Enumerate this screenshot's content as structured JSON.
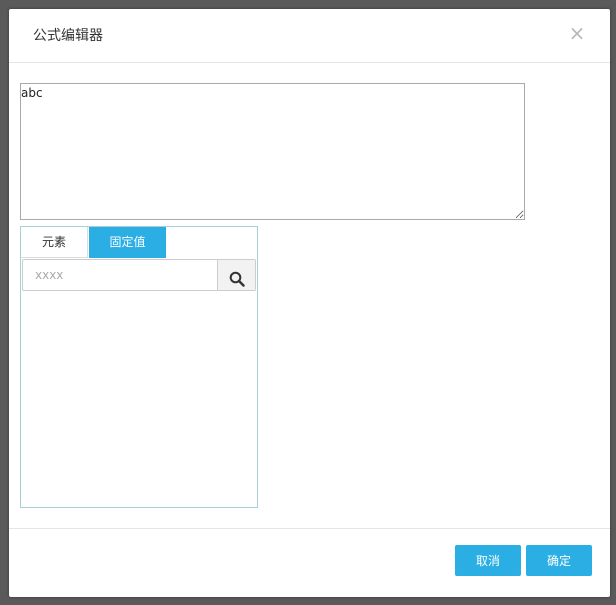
{
  "dialog": {
    "title": "公式编辑器",
    "close_label": "×"
  },
  "formula": {
    "value": "abc"
  },
  "tabs": [
    {
      "label": "元素",
      "active": false
    },
    {
      "label": "固定值",
      "active": true
    }
  ],
  "search": {
    "value": "",
    "placeholder": "xxxx",
    "icon": "search-icon"
  },
  "footer": {
    "cancel_label": "取消",
    "ok_label": "确定"
  },
  "colors": {
    "accent": "#2aaee3",
    "overlay": "#5a5a5a",
    "panel_border": "#a8cfd4"
  }
}
